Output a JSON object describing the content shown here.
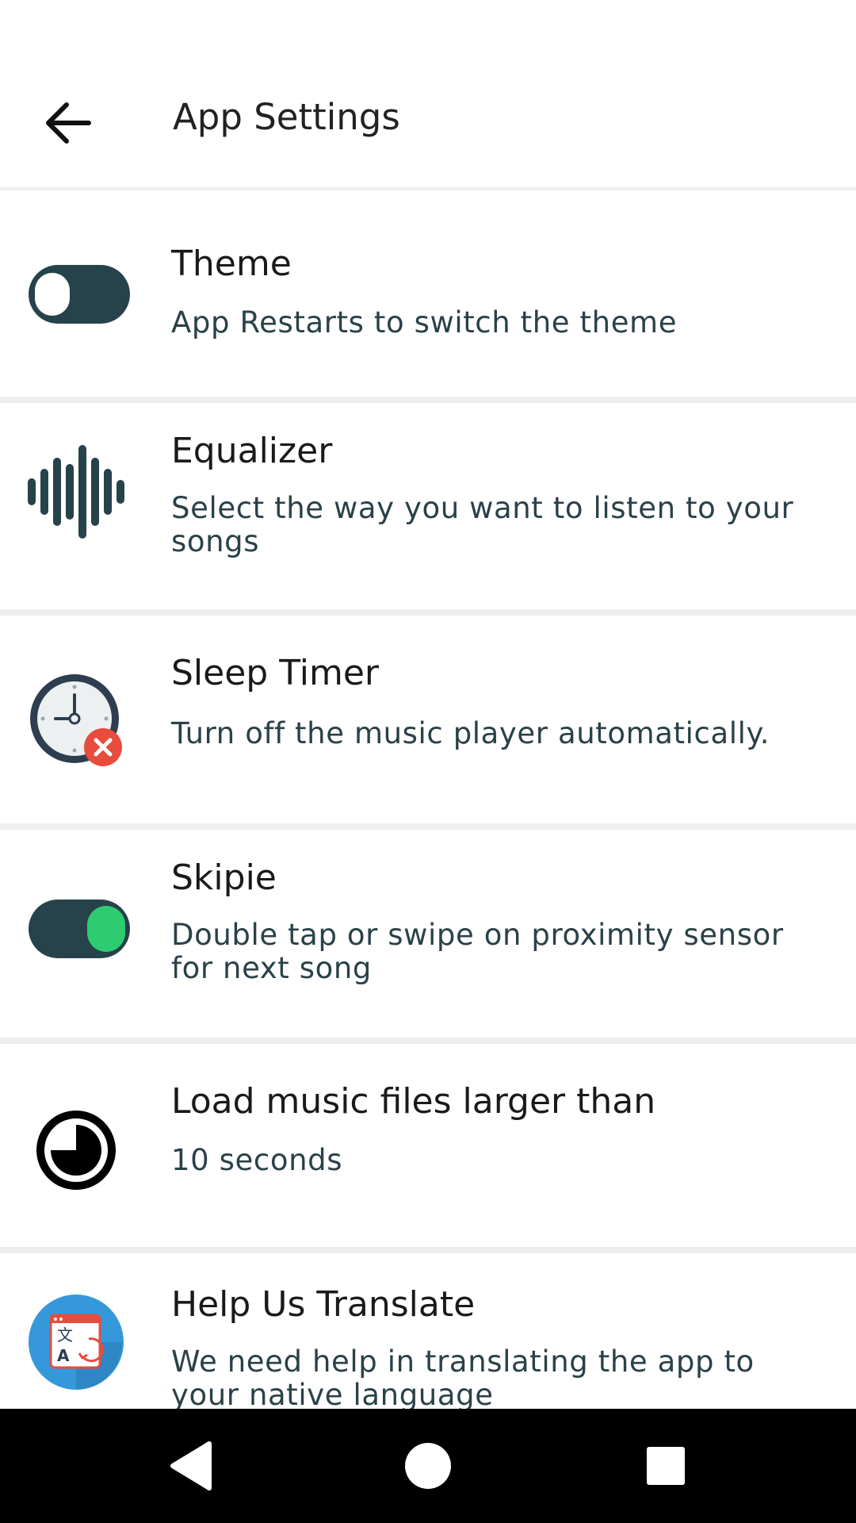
{
  "appbar": {
    "title": "App Settings",
    "back_icon": "arrow-back-icon"
  },
  "settings": [
    {
      "title": "Theme",
      "subtitle": "App Restarts to switch the theme",
      "icon": "toggle-switch-off-icon",
      "toggle_on": false
    },
    {
      "title": "Equalizer",
      "subtitle": "Select the way you want to listen to your songs",
      "icon": "sound-wave-icon"
    },
    {
      "title": "Sleep Timer",
      "subtitle": "Turn off the music player automatically.",
      "icon": "clock-cancel-icon"
    },
    {
      "title": "Skipie",
      "subtitle": "Double tap or swipe on proximity sensor for next song",
      "icon": "toggle-switch-on-icon",
      "toggle_on": true
    },
    {
      "title": "Load music files larger than",
      "subtitle": "10 seconds",
      "icon": "timer-pie-icon"
    },
    {
      "title": "Help Us Translate",
      "subtitle": "We need help in translating the app to your native language",
      "icon": "translate-icon"
    }
  ],
  "navbar": {
    "back_icon": "nav-back-triangle-icon",
    "home_icon": "nav-home-circle-icon",
    "recents_icon": "nav-recents-square-icon"
  },
  "colors": {
    "toggle_track": "#26424a",
    "toggle_on_thumb": "#2ecc71",
    "toggle_off_thumb": "#ffffff",
    "subtitle": "#2a4148",
    "divider": "#eeeeee",
    "clock_ring": "#2e3e50",
    "clock_face": "#ecf0f1",
    "cancel_badge": "#e74c3c",
    "translate_bg": "#3498db"
  }
}
